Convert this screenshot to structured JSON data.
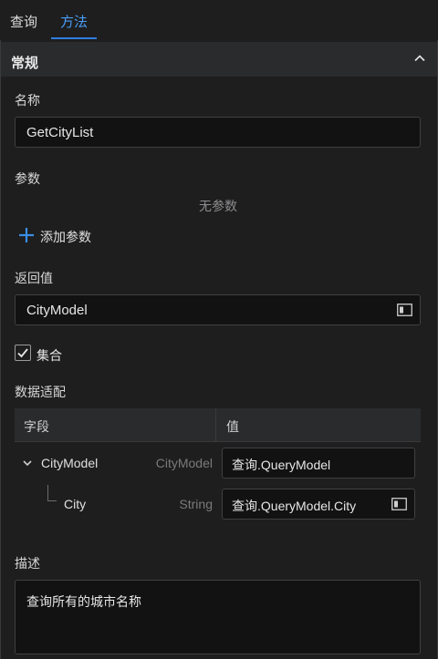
{
  "tabs": [
    {
      "label": "查询",
      "active": false
    },
    {
      "label": "方法",
      "active": true
    }
  ],
  "colors": {
    "accent": "#2f7de1",
    "background": "#1e1e1f",
    "input_bg": "#121213",
    "header_bg": "#2a2b2d"
  },
  "section": {
    "title": "常规",
    "icon": "chevron-up-icon"
  },
  "name": {
    "label": "名称",
    "value": "GetCityList"
  },
  "params": {
    "label": "参数",
    "empty_text": "无参数",
    "add_label": "添加参数",
    "add_icon": "plus-icon"
  },
  "return_value": {
    "label": "返回值",
    "value": "CityModel",
    "icon": "picker-icon"
  },
  "collection": {
    "label": "集合",
    "checked": true
  },
  "data_mapping": {
    "label": "数据适配",
    "columns": [
      "字段",
      "值"
    ],
    "rows": [
      {
        "field": "CityModel",
        "type": "CityModel",
        "value": "查询.QueryModel",
        "expanded": true
      },
      {
        "field": "City",
        "type": "String",
        "value": "查询.QueryModel.City"
      }
    ]
  },
  "description": {
    "label": "描述",
    "value": "查询所有的城市名称"
  }
}
